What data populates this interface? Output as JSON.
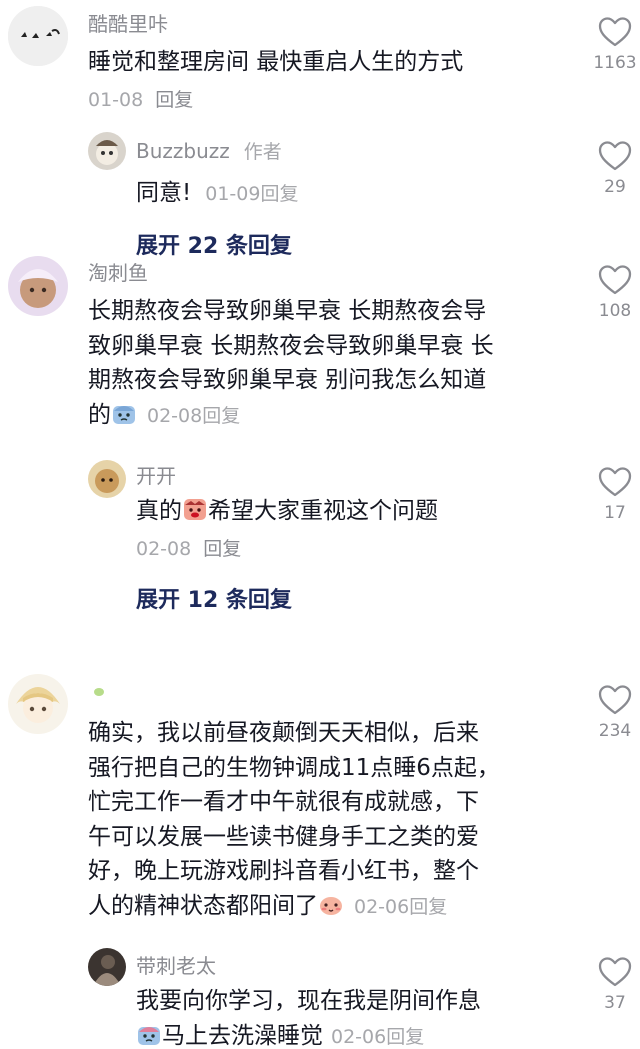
{
  "comments": [
    {
      "username": "酷酷里咔",
      "text": "睡觉和整理房间 最快重启人生的方式",
      "date": "01-08",
      "reply_label": "回复",
      "likes": "1163",
      "replies": [
        {
          "username": "Buzzbuzz",
          "author_tag": "作者",
          "text": "同意!",
          "date": "01-09",
          "reply_label": "回复",
          "likes": "29"
        }
      ],
      "expand_label": "展开 22 条回复"
    },
    {
      "username": "淘刺鱼",
      "text_lines": [
        "长期熬夜会导致卵巢早衰 长期熬夜会导",
        "致卵巢早衰 长期熬夜会导致卵巢早衰 长",
        "期熬夜会导致卵巢早衰 别问我怎么知道"
      ],
      "text_last": "的",
      "date": "02-08",
      "reply_label": "回复",
      "likes": "108",
      "replies": [
        {
          "username": "开开",
          "text_before": "真的",
          "text_after": "希望大家重视这个问题",
          "date": "02-08",
          "reply_label": "回复",
          "likes": "17"
        }
      ],
      "expand_label": "展开 12 条回复"
    },
    {
      "username": "",
      "text_lines": [
        "确实，我以前昼夜颠倒天天相似，后来",
        "强行把自己的生物钟调成11点睡6点起，",
        "忙完工作一看才中午就很有成就感，下",
        "午可以发展一些读书健身手工之类的爱",
        "好，晚上玩游戏刷抖音看小红书，整个"
      ],
      "text_last": "人的精神状态都阳间了",
      "date": "02-06",
      "reply_label": "回复",
      "likes": "234",
      "replies": [
        {
          "username": "带刺老太",
          "text_line1": "我要向你学习，现在我是阴间作息",
          "text_line2": "马上去洗澡睡觉",
          "date": "02-06",
          "reply_label": "回复",
          "likes": "37"
        }
      ]
    }
  ],
  "icons": {
    "like": "heart-outline-icon",
    "emoji_1": "crying-face-emoji",
    "emoji_2": "angry-face-emoji",
    "emoji_3": "blushing-face-emoji"
  },
  "colors": {
    "text": "#161823",
    "muted": "#8a8b91",
    "light": "#a6a7ab",
    "expand": "#1d2a5c"
  }
}
